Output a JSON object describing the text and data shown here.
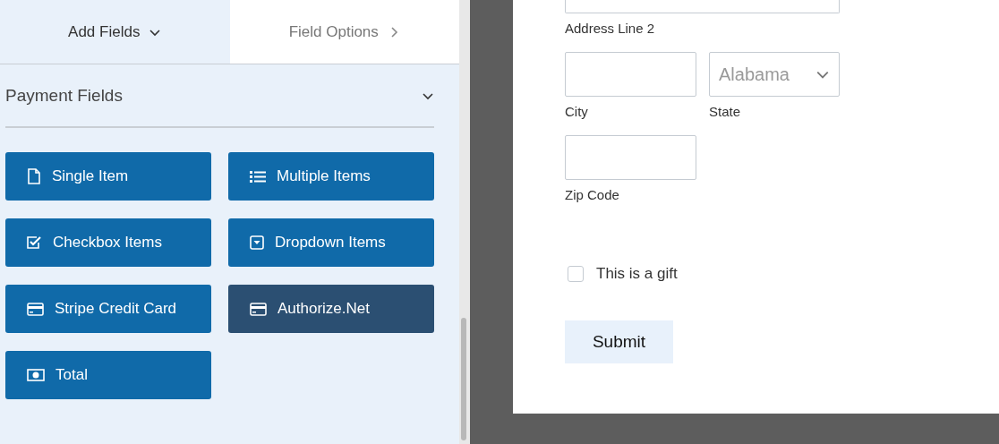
{
  "tabs": [
    {
      "label": "Add Fields",
      "selected": true
    },
    {
      "label": "Field Options",
      "selected": false
    }
  ],
  "section": {
    "title": "Payment Fields",
    "expanded": true
  },
  "field_buttons": [
    {
      "label": "Single Item",
      "kind": "file",
      "hovered": false
    },
    {
      "label": "Multiple Items",
      "kind": "list",
      "hovered": false
    },
    {
      "label": "Checkbox Items",
      "kind": "checkbox",
      "hovered": false
    },
    {
      "label": "Dropdown Items",
      "kind": "dropdown",
      "hovered": false
    },
    {
      "label": "Stripe Credit Card",
      "kind": "card",
      "hovered": false
    },
    {
      "label": "Authorize.Net",
      "kind": "card",
      "hovered": true
    },
    {
      "label": "Total",
      "kind": "money",
      "hovered": false
    }
  ],
  "form": {
    "address_line_2": {
      "label": "Address Line 2"
    },
    "city": {
      "label": "City"
    },
    "state": {
      "label": "State",
      "placeholder": "Alabama"
    },
    "zip": {
      "label": "Zip Code"
    },
    "gift": {
      "label": "This is a gift",
      "checked": false
    },
    "submit": "Submit"
  }
}
